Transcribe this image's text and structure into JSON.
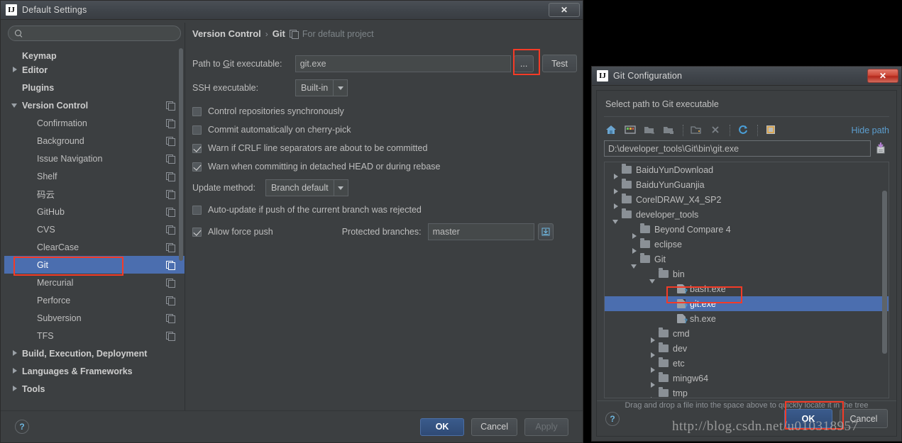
{
  "settings": {
    "title": "Default Settings",
    "close_label": "✕",
    "search": {
      "value": "",
      "placeholder": ""
    },
    "sidebar_items": [
      {
        "label": "Keymap",
        "indent": 0,
        "arrow": "none",
        "bold": true,
        "gear": false,
        "selected": false,
        "clipped": true
      },
      {
        "label": "Editor",
        "indent": 0,
        "arrow": "right",
        "bold": true,
        "gear": false,
        "selected": false
      },
      {
        "label": "Plugins",
        "indent": 0,
        "arrow": "none",
        "bold": true,
        "gear": false,
        "selected": false
      },
      {
        "label": "Version Control",
        "indent": 0,
        "arrow": "down",
        "bold": true,
        "gear": true,
        "selected": false
      },
      {
        "label": "Confirmation",
        "indent": 1,
        "arrow": "none",
        "bold": false,
        "gear": true,
        "selected": false
      },
      {
        "label": "Background",
        "indent": 1,
        "arrow": "none",
        "bold": false,
        "gear": true,
        "selected": false
      },
      {
        "label": "Issue Navigation",
        "indent": 1,
        "arrow": "none",
        "bold": false,
        "gear": true,
        "selected": false
      },
      {
        "label": "Shelf",
        "indent": 1,
        "arrow": "none",
        "bold": false,
        "gear": true,
        "selected": false
      },
      {
        "label": "码云",
        "indent": 1,
        "arrow": "none",
        "bold": false,
        "gear": true,
        "selected": false
      },
      {
        "label": "GitHub",
        "indent": 1,
        "arrow": "none",
        "bold": false,
        "gear": true,
        "selected": false
      },
      {
        "label": "CVS",
        "indent": 1,
        "arrow": "none",
        "bold": false,
        "gear": true,
        "selected": false
      },
      {
        "label": "ClearCase",
        "indent": 1,
        "arrow": "none",
        "bold": false,
        "gear": true,
        "selected": false
      },
      {
        "label": "Git",
        "indent": 1,
        "arrow": "none",
        "bold": false,
        "gear": true,
        "selected": true
      },
      {
        "label": "Mercurial",
        "indent": 1,
        "arrow": "none",
        "bold": false,
        "gear": true,
        "selected": false
      },
      {
        "label": "Perforce",
        "indent": 1,
        "arrow": "none",
        "bold": false,
        "gear": true,
        "selected": false
      },
      {
        "label": "Subversion",
        "indent": 1,
        "arrow": "none",
        "bold": false,
        "gear": true,
        "selected": false
      },
      {
        "label": "TFS",
        "indent": 1,
        "arrow": "none",
        "bold": false,
        "gear": true,
        "selected": false
      },
      {
        "label": "Build, Execution, Deployment",
        "indent": 0,
        "arrow": "right",
        "bold": true,
        "gear": false,
        "selected": false
      },
      {
        "label": "Languages & Frameworks",
        "indent": 0,
        "arrow": "right",
        "bold": true,
        "gear": false,
        "selected": false
      },
      {
        "label": "Tools",
        "indent": 0,
        "arrow": "right",
        "bold": true,
        "gear": false,
        "selected": false
      }
    ],
    "breadcrumb": {
      "part1": "Version Control",
      "separator": "›",
      "part2": "Git",
      "note": "For default project"
    },
    "git_path": {
      "label": "Path to Git executable:",
      "label_pre": "Path to ",
      "label_mnemonic": "G",
      "label_post": "it executable:",
      "value": "git.exe",
      "browse_label": "...",
      "test_label": "Test"
    },
    "ssh": {
      "label": "SSH executable:",
      "value": "Built-in"
    },
    "checkboxes": [
      {
        "label": "Control repositories synchronously",
        "checked": false
      },
      {
        "label": "Commit automatically on cherry-pick",
        "checked": false
      },
      {
        "label": "Warn if CRLF line separators are about to be committed",
        "checked": true
      },
      {
        "label": "Warn when committing in detached HEAD or during rebase",
        "checked": true
      }
    ],
    "update_method": {
      "label": "Update method:",
      "value": "Branch default"
    },
    "autoupdate": {
      "label": "Auto-update if push of the current branch was rejected",
      "checked": false
    },
    "force_push": {
      "label": "Allow force push",
      "checked": true
    },
    "protected_branches": {
      "label": "Protected branches:",
      "value": "master"
    },
    "footer": {
      "help_label": "?",
      "ok_label": "OK",
      "cancel_label": "Cancel",
      "apply_label": "Apply"
    }
  },
  "git_config": {
    "title": "Git Configuration",
    "close_label": "✕",
    "heading": "Select path to Git executable",
    "toolbar": [
      {
        "name": "home-icon"
      },
      {
        "name": "desktop-icon"
      },
      {
        "name": "expand-all-icon"
      },
      {
        "name": "collapse-all-icon"
      },
      {
        "name": "new-folder-icon"
      },
      {
        "name": "delete-icon"
      },
      {
        "name": "refresh-icon"
      },
      {
        "name": "show-hidden-files-icon"
      }
    ],
    "hide_path_label": "Hide path",
    "path_value": "D:\\developer_tools\\Git\\bin\\git.exe",
    "tree": [
      {
        "label": "BaiduYunDownload",
        "depth": 0,
        "arrow": "right",
        "type": "folder",
        "selected": false
      },
      {
        "label": "BaiduYunGuanjia",
        "depth": 0,
        "arrow": "right",
        "type": "folder",
        "selected": false
      },
      {
        "label": "CorelDRAW_X4_SP2",
        "depth": 0,
        "arrow": "right",
        "type": "folder",
        "selected": false
      },
      {
        "label": "developer_tools",
        "depth": 0,
        "arrow": "down",
        "type": "folder",
        "selected": false
      },
      {
        "label": "Beyond Compare 4",
        "depth": 1,
        "arrow": "right",
        "type": "folder",
        "selected": false
      },
      {
        "label": "eclipse",
        "depth": 1,
        "arrow": "right",
        "type": "folder",
        "selected": false
      },
      {
        "label": "Git",
        "depth": 1,
        "arrow": "down",
        "type": "folder",
        "selected": false
      },
      {
        "label": "bin",
        "depth": 2,
        "arrow": "down",
        "type": "folder",
        "selected": false
      },
      {
        "label": "bash.exe",
        "depth": 3,
        "arrow": "none",
        "type": "exe",
        "selected": false
      },
      {
        "label": "git.exe",
        "depth": 3,
        "arrow": "none",
        "type": "exe",
        "selected": true
      },
      {
        "label": "sh.exe",
        "depth": 3,
        "arrow": "none",
        "type": "exe",
        "selected": false
      },
      {
        "label": "cmd",
        "depth": 2,
        "arrow": "right",
        "type": "folder",
        "selected": false
      },
      {
        "label": "dev",
        "depth": 2,
        "arrow": "right",
        "type": "folder",
        "selected": false
      },
      {
        "label": "etc",
        "depth": 2,
        "arrow": "right",
        "type": "folder",
        "selected": false
      },
      {
        "label": "mingw64",
        "depth": 2,
        "arrow": "right",
        "type": "folder",
        "selected": false
      },
      {
        "label": "tmp",
        "depth": 2,
        "arrow": "right",
        "type": "folder",
        "selected": false
      }
    ],
    "dnd_hint": "Drag and drop a file into the space above to quickly locate it in the tree",
    "footer": {
      "help_label": "?",
      "ok_label": "OK",
      "cancel_label": "Cancel"
    }
  },
  "watermark": "http://blog.csdn.net/u010318957",
  "colors": {
    "accent_selection": "#4b6eaf",
    "highlight_box": "#f43b27",
    "link": "#5c9ecf",
    "window_bg": "#3c3f41"
  }
}
